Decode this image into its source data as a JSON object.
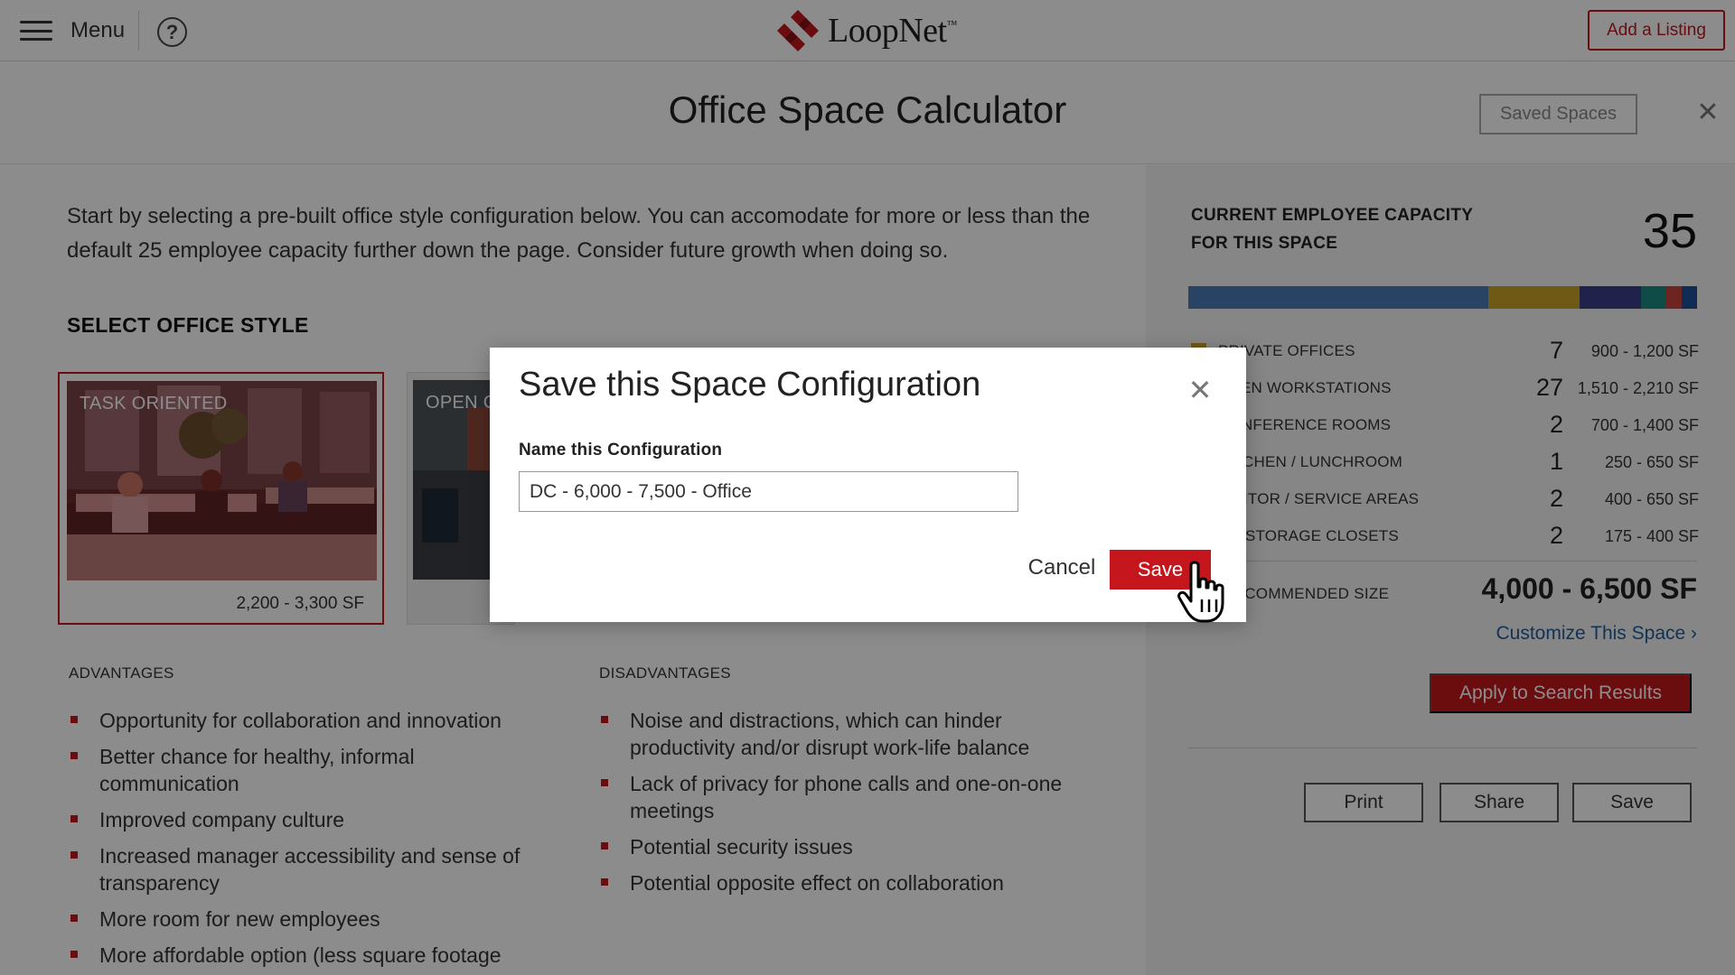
{
  "topbar": {
    "menu_label": "Menu",
    "help_glyph": "?",
    "logo_text": "LoopNet",
    "logo_tm": "™",
    "add_listing": "Add a Listing"
  },
  "header": {
    "title": "Office Space Calculator",
    "saved_spaces": "Saved Spaces",
    "close_glyph": "✕"
  },
  "intro": "Start by selecting a pre-built office style configuration below. You can accomodate for more or less than the default 25 employee capacity further down the page. Consider future growth when doing so.",
  "select_title": "SELECT OFFICE STYLE",
  "cards": [
    {
      "label": "TASK ORIENTED",
      "range": "2,200 - 3,300 SF"
    },
    {
      "label": "OPEN C"
    }
  ],
  "advantages": {
    "title": "ADVANTAGES",
    "items": [
      "Opportunity for collaboration and innovation",
      "Better chance for healthy, informal communication",
      "Improved company culture",
      "Increased manager accessibility and sense of transparency",
      "More room for new employees",
      "More affordable option  (less square footage"
    ]
  },
  "disadvantages": {
    "title": "DISADVANTAGES",
    "items": [
      "Noise and distractions, which can hinder productivity and/or disrupt work-life balance",
      "Lack of privacy for phone calls and one-on-one meetings",
      "Potential security issues",
      "Potential opposite effect on collaboration"
    ]
  },
  "capacity": {
    "label": "CURRENT EMPLOYEE CAPACITY FOR THIS SPACE",
    "value": "35",
    "bar_segments": [
      {
        "color": "#4a7bb5",
        "fraction": 0.59
      },
      {
        "color": "#c9a227",
        "fraction": 0.18
      },
      {
        "color": "#3b3f8a",
        "fraction": 0.12
      },
      {
        "color": "#1d8a83",
        "fraction": 0.05
      },
      {
        "color": "#c8433c",
        "fraction": 0.03
      },
      {
        "color": "#1e4f9a",
        "fraction": 0.03
      }
    ]
  },
  "spaces": [
    {
      "name": "PRIVATE OFFICES",
      "count": "7",
      "sf": "900 - 1,200 SF",
      "color": "#c9a227"
    },
    {
      "name": "OPEN WORKSTATIONS",
      "count": "27",
      "sf": "1,510 - 2,210 SF",
      "color": "#4a7bb5"
    },
    {
      "name": "CONFERENCE ROOMS",
      "count": "2",
      "sf": "700 - 1,400 SF",
      "color": "#3b3f8a"
    },
    {
      "name": "KITCHEN / LUNCHROOM",
      "count": "1",
      "sf": "250 - 650 SF",
      "color": "#1d8a83"
    },
    {
      "name": "VISITOR / SERVICE AREAS",
      "count": "2",
      "sf": "400 - 650 SF",
      "color": "#c8433c"
    },
    {
      "name": "IT / STORAGE CLOSETS",
      "count": "2",
      "sf": "175 - 400 SF",
      "color": "#1e4f9a"
    }
  ],
  "recommended": {
    "label": "RECOMMENDED SIZE",
    "value": "4,000 - 6,500 SF"
  },
  "customize": "Customize This Space ›",
  "apply": "Apply to Search Results",
  "actions": {
    "print": "Print",
    "share": "Share",
    "save": "Save"
  },
  "modal": {
    "title": "Save this Space Configuration",
    "close_glyph": "✕",
    "field_label": "Name this Configuration",
    "field_value": "DC - 6,000 - 7,500 - Office",
    "cancel": "Cancel",
    "save": "Save"
  },
  "colors": {
    "brand_red": "#c4161c",
    "link_blue": "#1f5e9e"
  }
}
